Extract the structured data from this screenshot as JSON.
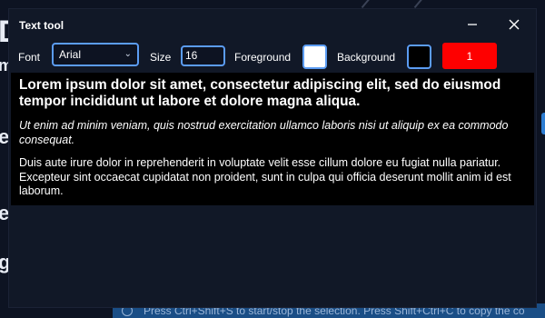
{
  "background_app": {
    "status_text": "Press Ctrl+Shift+S to start/stop the selection. Press Shift+Ctrl+C to copy the co",
    "side_glyphs": [
      "D",
      "m",
      "e",
      "e",
      "g"
    ]
  },
  "dialog": {
    "title": "Text tool"
  },
  "toolbar": {
    "font_label": "Font",
    "font_value": "Arial",
    "size_label": "Size",
    "size_value": "16",
    "foreground_label": "Foreground",
    "foreground_color": "#ffffff",
    "background_label": "Background",
    "background_color": "#000000",
    "action_button_label": "1",
    "action_button_color": "#fe0000"
  },
  "preview": {
    "bold_text": "Lorem ipsum dolor sit amet, consectetur adipiscing elit, sed do eiusmod tempor incididunt ut labore et dolore magna aliqua.",
    "italic_text": "Ut enim ad minim veniam, quis nostrud exercitation ullamco laboris nisi ut aliquip ex ea commodo consequat.",
    "normal_text": "Duis aute irure dolor in reprehenderit in voluptate velit esse cillum dolore eu fugiat nulla pariatur. Excepteur sint occaecat cupidatat non proident, sunt in culpa qui officia deserunt mollit anim id est laborum."
  },
  "colors": {
    "accent": "#5b9cf3",
    "dialog_bg": "#111827",
    "app_bg": "#0d1322"
  }
}
